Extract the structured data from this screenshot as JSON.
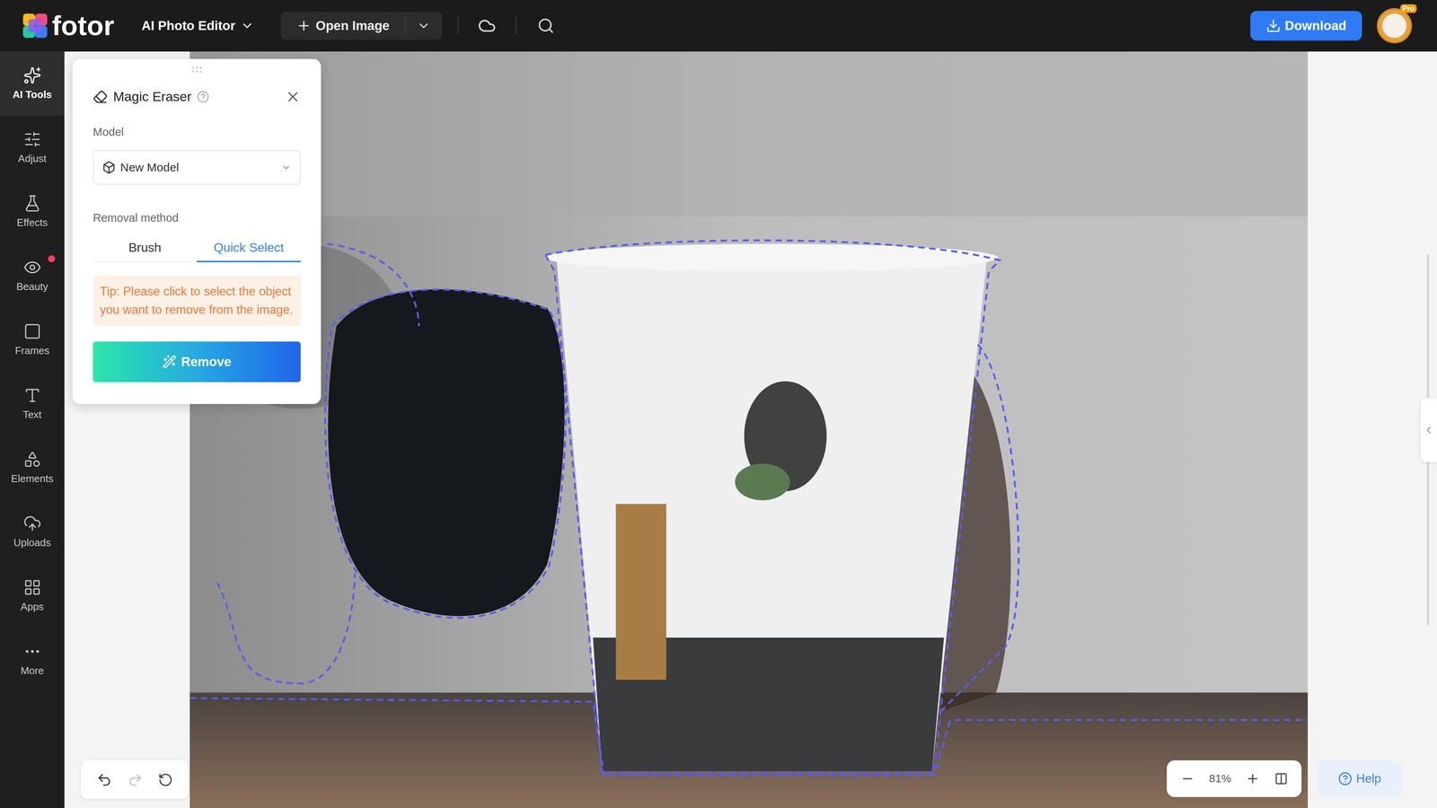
{
  "topbar": {
    "logo": "fotor",
    "mode_menu": "AI Photo Editor",
    "open_image": "Open Image",
    "download": "Download",
    "avatar_badge": "Pro"
  },
  "sidebar": {
    "items": [
      {
        "label": "AI Tools",
        "selected": true,
        "badge": false
      },
      {
        "label": "Adjust",
        "selected": false,
        "badge": false
      },
      {
        "label": "Effects",
        "selected": false,
        "badge": false
      },
      {
        "label": "Beauty",
        "selected": false,
        "badge": true
      },
      {
        "label": "Frames",
        "selected": false,
        "badge": false
      },
      {
        "label": "Text",
        "selected": false,
        "badge": false
      },
      {
        "label": "Elements",
        "selected": false,
        "badge": false
      },
      {
        "label": "Uploads",
        "selected": false,
        "badge": false
      },
      {
        "label": "Apps",
        "selected": false,
        "badge": false
      },
      {
        "label": "More",
        "selected": false,
        "badge": false
      }
    ]
  },
  "panel": {
    "title": "Magic Eraser",
    "model_label": "Model",
    "model_value": "New Model",
    "removal_label": "Removal method",
    "methods": [
      {
        "label": "Brush",
        "selected": false
      },
      {
        "label": "Quick Select",
        "selected": true
      }
    ],
    "tip": "Tip: Please click to select the object you want to remove from the image.",
    "remove_button": "Remove"
  },
  "history": {
    "undo_disabled": false,
    "redo_disabled": true
  },
  "zoom": {
    "value": "81%"
  },
  "help": "Help"
}
